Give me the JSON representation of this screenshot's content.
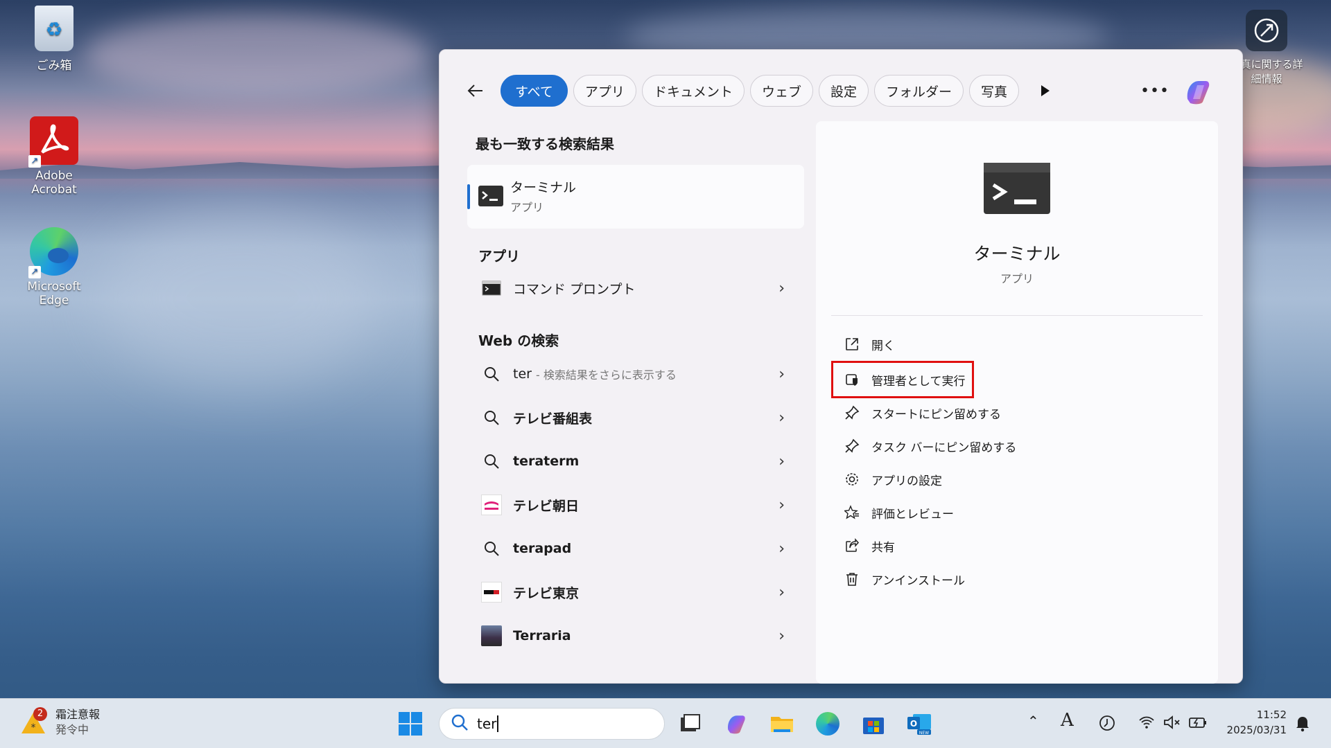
{
  "desktop": {
    "icons": [
      {
        "label": "ごみ箱"
      },
      {
        "label": "Adobe Acrobat"
      },
      {
        "label": "Microsoft Edge"
      }
    ],
    "photo_info": {
      "line1": "写真に関する詳",
      "line2": "細情報"
    }
  },
  "search_panel": {
    "filters": [
      "すべて",
      "アプリ",
      "ドキュメント",
      "ウェブ",
      "設定",
      "フォルダー",
      "写真"
    ],
    "active_filter": "すべて",
    "best_match": {
      "title": "最も一致する検索結果",
      "name": "ターミナル",
      "type": "アプリ"
    },
    "apps_section": {
      "title": "アプリ",
      "items": [
        {
          "name": "コマンド プロンプト"
        }
      ]
    },
    "web_section": {
      "title": "Web の検索",
      "items": [
        {
          "name": "ter",
          "sub": "- 検索結果をさらに表示する",
          "icon": "search-icon"
        },
        {
          "name": "テレビ番組表",
          "icon": "search-icon"
        },
        {
          "name": "teraterm",
          "icon": "search-icon"
        },
        {
          "name": "テレビ朝日",
          "icon": "tv-asahi-logo"
        },
        {
          "name": "terapad",
          "icon": "search-icon"
        },
        {
          "name": "テレビ東京",
          "icon": "tv-tokyo-logo"
        },
        {
          "name": "Terraria",
          "icon": "terraria-thumbnail"
        }
      ]
    },
    "details": {
      "name": "ターミナル",
      "type": "アプリ",
      "actions": [
        {
          "label": "開く",
          "icon": "open-external-icon"
        },
        {
          "label": "管理者として実行",
          "icon": "shield-icon"
        },
        {
          "label": "スタートにピン留めする",
          "icon": "pin-icon"
        },
        {
          "label": "タスク バーにピン留めする",
          "icon": "pin-icon"
        },
        {
          "label": "アプリの設定",
          "icon": "gear-icon"
        },
        {
          "label": "評価とレビュー",
          "icon": "star-icon"
        },
        {
          "label": "共有",
          "icon": "share-icon"
        },
        {
          "label": "アンインストール",
          "icon": "trash-icon"
        }
      ],
      "highlighted_action": "管理者として実行"
    }
  },
  "taskbar": {
    "weather": {
      "badge": "2",
      "line1": "霜注意報",
      "line2": "発令中"
    },
    "search_value": "ter",
    "clock": {
      "time": "11:52",
      "date": "2025/03/31"
    },
    "ime": "A"
  },
  "colors": {
    "accent": "#1f6fcf",
    "highlight": "#e01010"
  }
}
